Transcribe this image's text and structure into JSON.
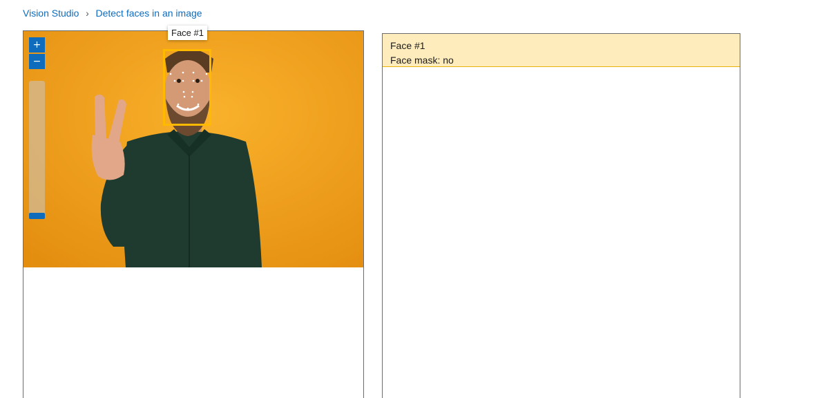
{
  "breadcrumb": {
    "items": [
      "Vision Studio",
      "Detect faces in an image"
    ],
    "separator": "›"
  },
  "image_panel": {
    "tooltip": "Face #1",
    "zoom_in_label": "+",
    "zoom_out_label": "−",
    "zoom_level_fraction": 0.0,
    "face_box_color": "#ffb900"
  },
  "results": {
    "cards": [
      {
        "title": "Face #1",
        "detail": "Face mask: no"
      }
    ]
  },
  "colors": {
    "accent": "#0f6cbd",
    "highlight_bg": "#ffecbc",
    "photo_background": "#f2a31c"
  }
}
